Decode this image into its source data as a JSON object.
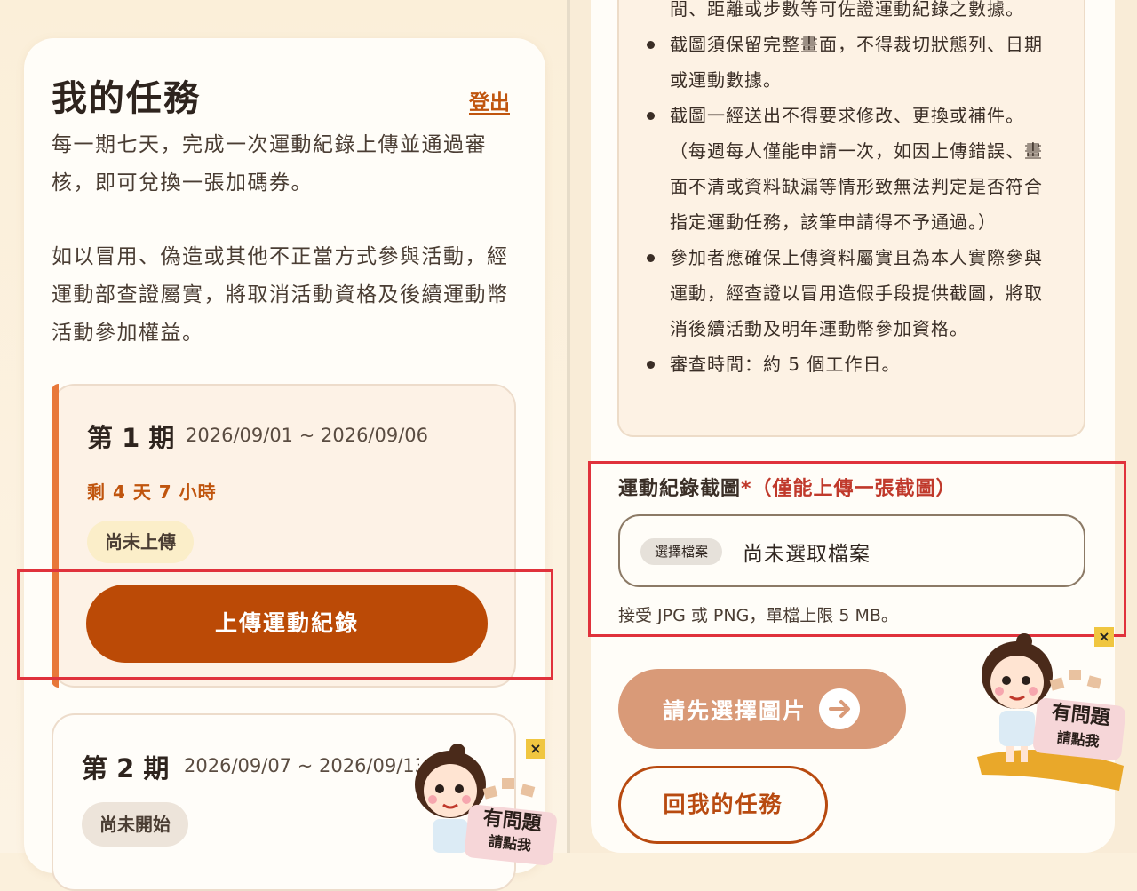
{
  "left": {
    "title": "我的任務",
    "logout": "登出",
    "intro_1": "每一期七天，完成一次運動紀錄上傳並通過審核，即可兌換一張加碼券。",
    "intro_2": "如以冒用、偽造或其他不正當方式參與活動，經運動部查證屬實，將取消活動資格及後續運動幣活動參加權益。",
    "period1": {
      "title": "第 1 期",
      "range": "2026/09/01 ~ 2026/09/06",
      "remaining": "剩 4 天 7 小時",
      "status": "尚未上傳",
      "upload_button": "上傳運動紀錄"
    },
    "period2": {
      "title": "第 2 期",
      "range": "2026/09/07 ~ 2026/09/13",
      "status": "尚未開始"
    }
  },
  "right": {
    "rules": [
      {
        "text": "間、距離或步數等可佐證運動紀錄之數據。",
        "bullet": false
      },
      {
        "text": "截圖須保留完整畫面，不得裁切狀態列、日期或運動數據。",
        "bullet": true
      },
      {
        "text": "截圖一經送出不得要求修改、更換或補件。（每週每人僅能申請一次，如因上傳錯誤、畫面不清或資料缺漏等情形致無法判定是否符合指定運動任務，該筆申請得不予通過。）",
        "bullet": true
      },
      {
        "text": "參加者應確保上傳資料屬實且為本人實際參與運動，經查證以冒用造假手段提供截圖，將取消後續活動及明年運動幣參加資格。",
        "bullet": true
      },
      {
        "text": "審查時間：約 5 個工作日。",
        "bullet": true
      }
    ],
    "upload_label": "運動紀錄截圖",
    "required_mark": "*",
    "upload_note": "（僅能上傳一張截圖）",
    "file_button": "選擇檔案",
    "file_status": "尚未選取檔案",
    "file_hint": "接受 JPG 或 PNG，單檔上限 5 MB。",
    "submit_button": "請先選擇圖片",
    "back_button": "回我的任務"
  },
  "help": {
    "close": "×",
    "line1": "有問題",
    "line2": "請點我"
  },
  "colors": {
    "accent": "#bb4a06",
    "highlight": "#e0323c",
    "disabled_button": "#d99a78"
  }
}
